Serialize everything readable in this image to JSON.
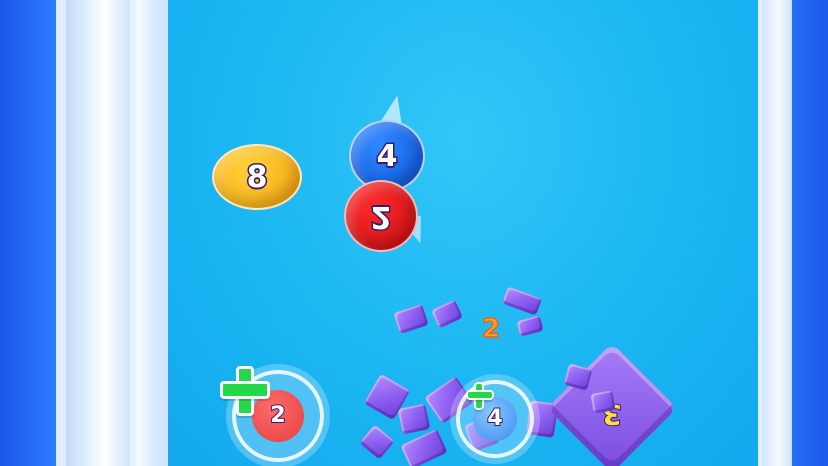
{
  "balls": {
    "yellow": "8",
    "blue": "4",
    "red": "2"
  },
  "floating_number": "2",
  "bubbles": {
    "left": "2",
    "right": "4"
  },
  "block_number": "3",
  "colors": {
    "playfield": "#1bb6f2",
    "wall": "#eaf4ff",
    "shard": "#8a5cf0",
    "plus": "#25d84a"
  }
}
